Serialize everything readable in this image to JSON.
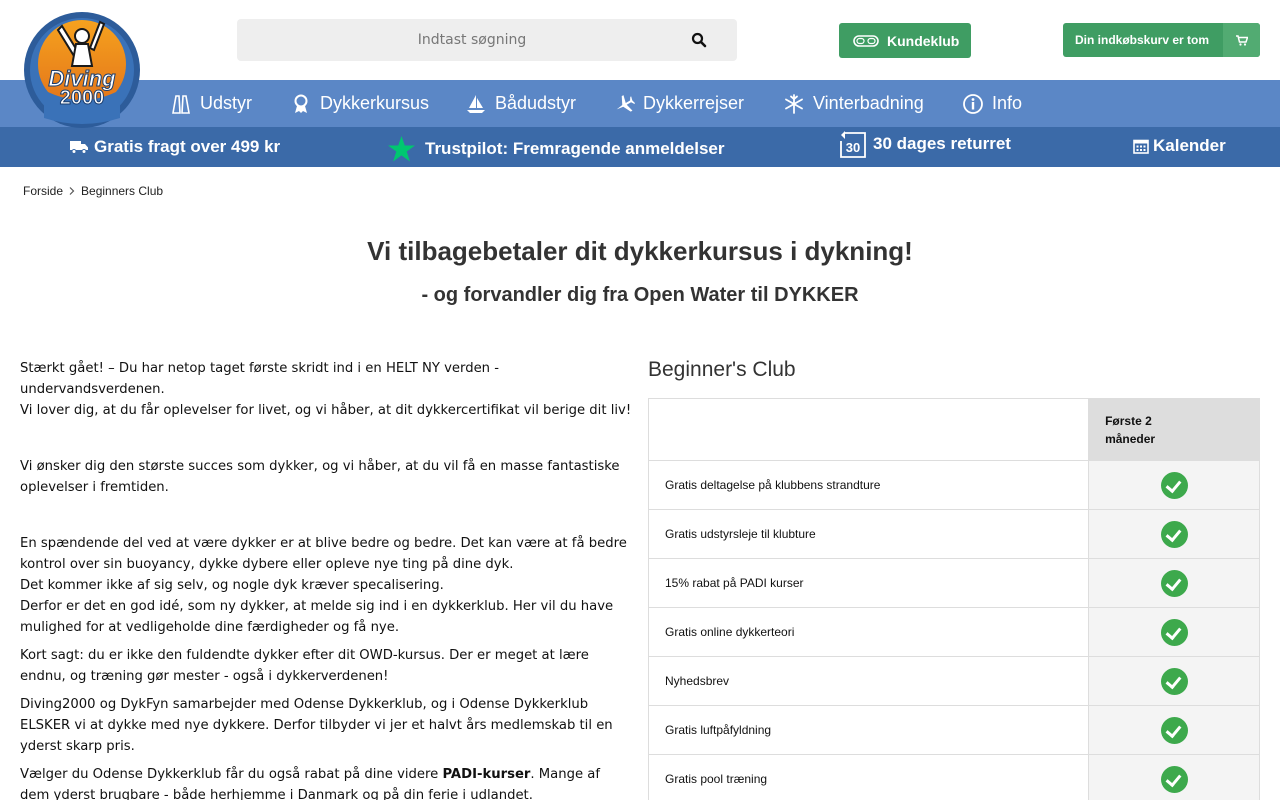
{
  "header": {
    "logo_text": "Diving 2000",
    "search_placeholder": "Indtast søgning",
    "kundeklub_label": "Kundeklub",
    "cart_label": "Din indkøbskurv er tom"
  },
  "nav": {
    "items": [
      {
        "label": "Udstyr",
        "icon": "fins-icon"
      },
      {
        "label": "Dykkerkursus",
        "icon": "award-icon"
      },
      {
        "label": "Bådudstyr",
        "icon": "boat-icon"
      },
      {
        "label": "Dykkerrejser",
        "icon": "plane-icon"
      },
      {
        "label": "Vinterbadning",
        "icon": "snowflake-icon"
      },
      {
        "label": "Info",
        "icon": "info-icon"
      }
    ]
  },
  "usp": {
    "shipping": "Gratis fragt over 499 kr",
    "trustpilot": "Trustpilot: Fremragende anmeldelser",
    "returns_number": "30",
    "returns": "30 dages returret",
    "calendar": "Kalender"
  },
  "breadcrumb": {
    "home": "Forside",
    "current": "Beginners Club"
  },
  "hero": {
    "title": "Vi tilbagebetaler dit dykkerkursus i dykning!",
    "subtitle": "- og forvandler dig fra Open Water til DYKKER"
  },
  "body": {
    "p1_l1": "Stærkt gået! – Du har netop taget første skridt ind i en HELT NY verden - undervandsverdenen.",
    "p1_l2": "Vi lover dig, at du får oplevelser for livet, og vi håber, at dit dykkercertifikat vil berige dit liv!",
    "p2": "Vi ønsker dig den største succes som dykker, og vi håber, at du vil få en masse fantastiske oplevelser i fremtiden.",
    "p3_l1": "En spændende del ved at være dykker er at blive bedre og bedre. Det kan være at få bedre kontrol over sin buoyancy, dykke dybere eller opleve nye ting på dine dyk.",
    "p3_l2": "Det kommer ikke af sig selv, og nogle dyk kræver specalisering.",
    "p3_l3": "Derfor er det en god idé, som ny dykker, at melde sig ind i en dykkerklub. Her vil du have mulighed for at vedligeholde dine færdigheder og få nye.",
    "p4": "Kort sagt: du er ikke den fuldendte dykker efter dit OWD-kursus. Der er meget at lære endnu, og træning gør mester - også i dykkerverdenen!",
    "p5": "Diving2000 og DykFyn samarbejder med Odense Dykkerklub, og i Odense Dykkerklub ELSKER vi at dykke med nye dykkere. Derfor tilbyder vi jer et halvt års medlemskab til en yderst skarp pris.",
    "p6_a": "Vælger du Odense Dykkerklub får du også rabat på dine videre ",
    "p6_bold": "PADI-kurser",
    "p6_b": ". Mange af dem yderst brugbare - både herhjemme i Danmark og på din ferie i udlandet."
  },
  "club": {
    "title": "Beginner's Club",
    "period_header": "Første 2 måneder",
    "features": [
      "Gratis deltagelse på klubbens strandture",
      "Gratis udstyrsleje til klubture",
      "15% rabat på PADI kurser",
      "Gratis online dykkerteori",
      "Nyhedsbrev",
      "Gratis luftpåfyldning",
      "Gratis pool træning"
    ]
  },
  "colors": {
    "nav": "#5b87c6",
    "usp": "#3b6aa8",
    "green": "#3f9d63",
    "check": "#3da94c"
  }
}
